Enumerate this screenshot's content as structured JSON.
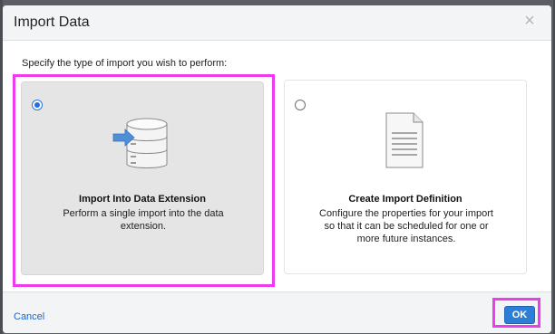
{
  "dialog": {
    "title": "Import Data",
    "close_icon": "close-icon",
    "instruction": "Specify the type of import you wish to perform:"
  },
  "options": [
    {
      "title": "Import Into Data Extension",
      "desc_line1": "Perform a single import into the data",
      "desc_line2": "extension.",
      "selected": true,
      "icon": "database-import-icon"
    },
    {
      "title": "Create Import Definition",
      "desc_line1": "Configure the properties for your import",
      "desc_line2": "so that it can be scheduled for one or",
      "desc_line3": "more future instances.",
      "selected": false,
      "icon": "document-icon"
    }
  ],
  "footer": {
    "cancel_label": "Cancel",
    "ok_label": "OK"
  },
  "colors": {
    "highlight": "#ee3bf0",
    "primary": "#2d7fd6",
    "link": "#1a66c9"
  }
}
